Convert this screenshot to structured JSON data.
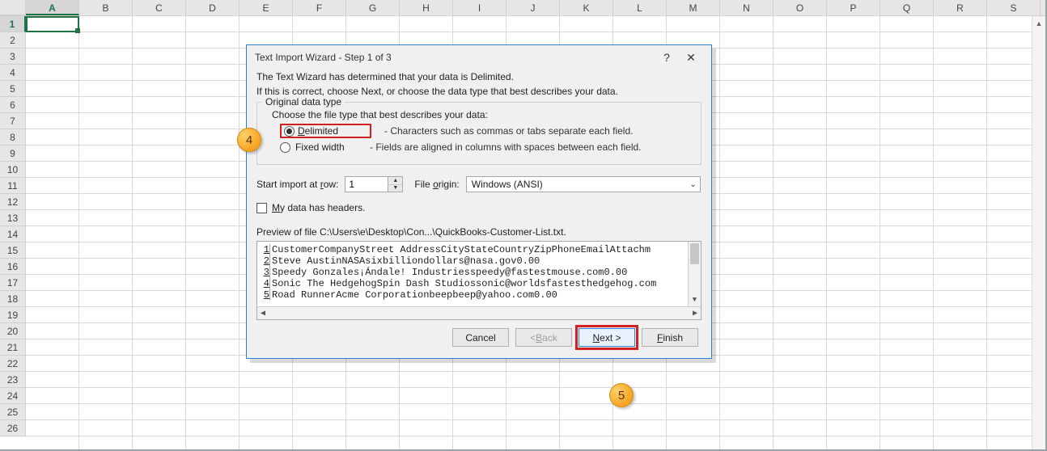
{
  "columns": [
    "A",
    "B",
    "C",
    "D",
    "E",
    "F",
    "G",
    "H",
    "I",
    "J",
    "K",
    "L",
    "M",
    "N",
    "O",
    "P",
    "Q",
    "R",
    "S"
  ],
  "rows": [
    1,
    2,
    3,
    4,
    5,
    6,
    7,
    8,
    9,
    10,
    11,
    12,
    13,
    14,
    15,
    16,
    17,
    18,
    19,
    20,
    21,
    22,
    23,
    24,
    25,
    26
  ],
  "selected_col": "A",
  "selected_row": 1,
  "dialog": {
    "title": "Text Import Wizard - Step 1 of 3",
    "help": "?",
    "close": "✕",
    "intro1": "The Text Wizard has determined that your data is Delimited.",
    "intro2": "If this is correct, choose Next, or choose the data type that best describes your data.",
    "group_legend": "Original data type",
    "choose_label": "Choose the file type that best describes your data:",
    "opt_delimited": {
      "label_pre": "D",
      "label_rest": "elimited",
      "desc": "- Characters such as commas or tabs separate each field."
    },
    "opt_fixed": {
      "label": "Fixed width",
      "desc": "- Fields are aligned in columns with spaces between each field."
    },
    "start_row_label_pre": "Start import at ",
    "start_row_label_u": "r",
    "start_row_label_post": "ow:",
    "start_row_value": "1",
    "file_origin_label_pre": "File ",
    "file_origin_label_u": "o",
    "file_origin_label_post": "rigin:",
    "file_origin_value": "Windows (ANSI)",
    "headers_label_pre": "M",
    "headers_label_rest": "y data has headers.",
    "preview_label": "Preview of file C:\\Users\\e\\Desktop\\Con...\\QuickBooks-Customer-List.txt.",
    "preview_lines": [
      "CustomerCompanyStreet AddressCityStateCountryZipPhoneEmailAttachm",
      "Steve AustinNASAsixbilliondollars@nasa.gov0.00",
      "Speedy Gonzales¡Ándale! Industriesspeedy@fastestmouse.com0.00",
      "Sonic The HedgehogSpin Dash Studiossonic@worldsfastesthedgehog.com",
      "Road RunnerAcme Corporationbeepbeep@yahoo.com0.00"
    ],
    "buttons": {
      "cancel": "Cancel",
      "back_pre": "< ",
      "back_u": "B",
      "back_post": "ack",
      "next_u": "N",
      "next_post": "ext >",
      "finish_u": "F",
      "finish_post": "inish"
    }
  },
  "badges": {
    "b4": "4",
    "b5": "5"
  }
}
